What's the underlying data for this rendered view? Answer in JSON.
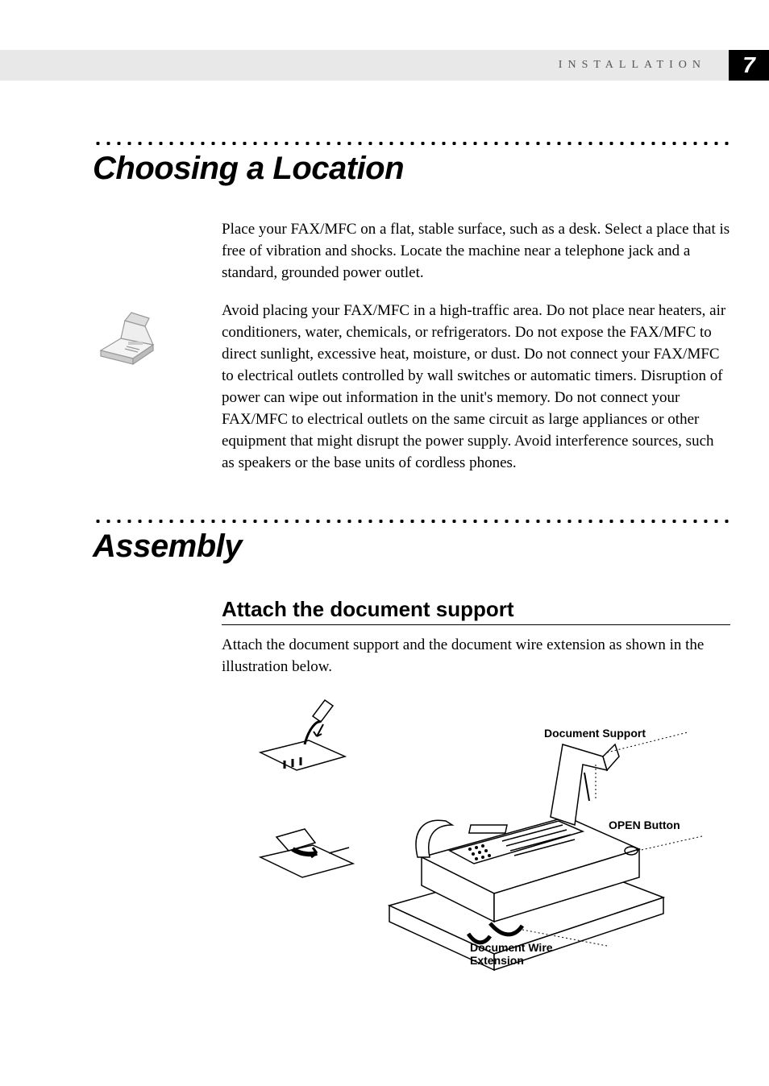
{
  "header": {
    "sectionLabel": "INSTALLATION",
    "pageNumber": "7"
  },
  "section1": {
    "title": "Choosing a Location",
    "para1": "Place your FAX/MFC on a flat, stable surface, such as a desk. Select a place that is free of vibration and shocks. Locate the machine near a telephone jack and a standard, grounded power outlet.",
    "para2": "Avoid placing your FAX/MFC in a high-traffic area. Do not place near heaters, air conditioners, water, chemicals, or refrigerators. Do not expose the FAX/MFC to direct sunlight, excessive heat, moisture, or dust. Do not connect your FAX/MFC to electrical outlets controlled by wall switches or automatic timers. Disruption of power can wipe out information in the unit's memory. Do not connect your FAX/MFC to electrical outlets on the same circuit as large appliances or other equipment that might disrupt the power supply. Avoid interference sources, such as speakers or the base units of cordless phones."
  },
  "section2": {
    "title": "Assembly",
    "subhead": "Attach the document support",
    "para1": "Attach the document support and the document wire extension as shown in the illustration below.",
    "callouts": {
      "docSupport": "Document Support",
      "openButton": "OPEN Button",
      "docWireL1": "Document Wire",
      "docWireL2": "Extension"
    }
  }
}
